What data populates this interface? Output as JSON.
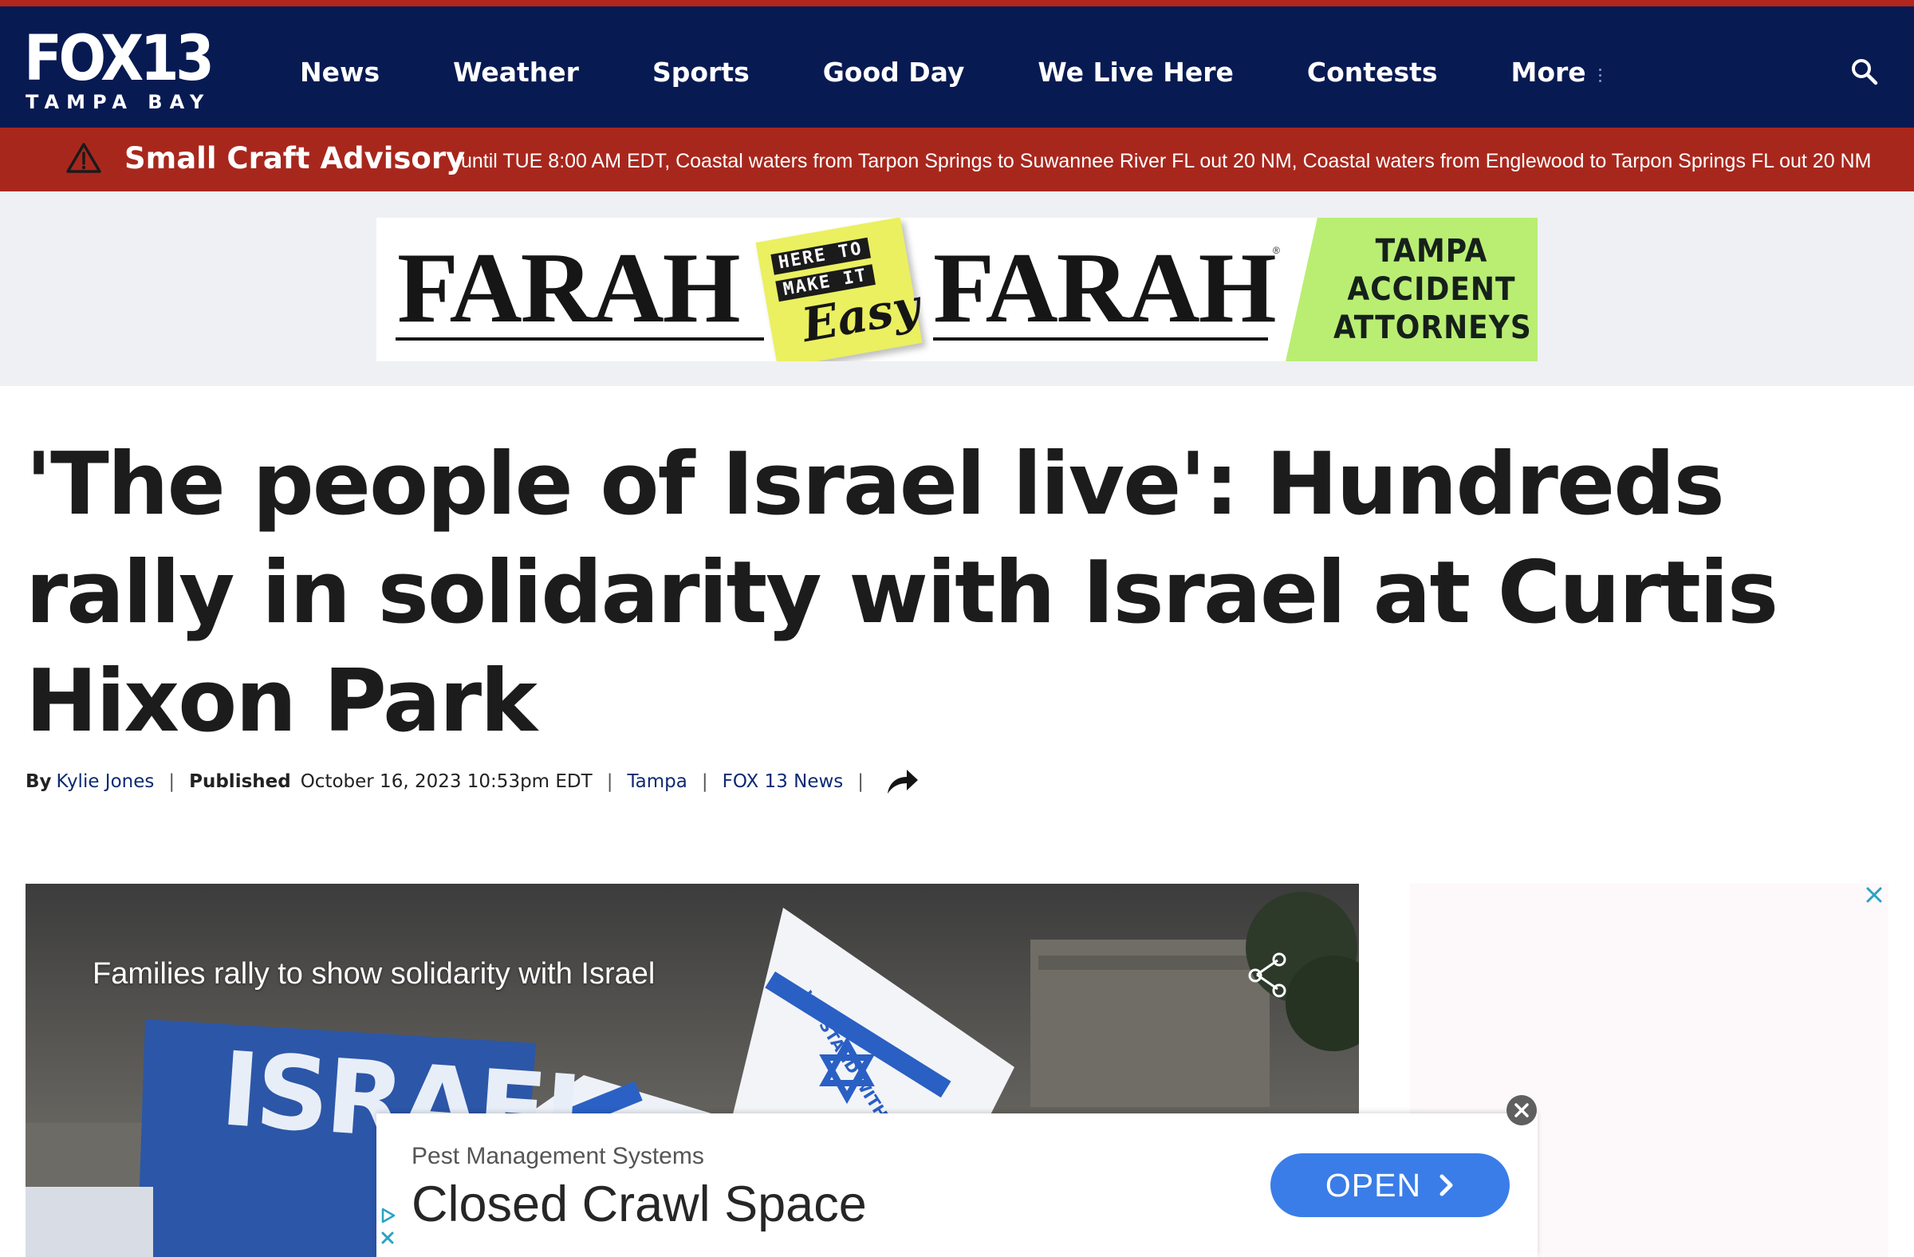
{
  "brand": {
    "logo_main": "FOX13",
    "logo_sub": "TAMPA BAY",
    "nav_color": "#081a52",
    "alert_color": "#a8271d",
    "accent": "#b3261e"
  },
  "nav": {
    "items": [
      "News",
      "Weather",
      "Sports",
      "Good Day",
      "We Live Here",
      "Contests",
      "More"
    ],
    "search_icon": "search-icon"
  },
  "alert": {
    "icon": "warning-triangle-icon",
    "title": "Small Craft Advisory",
    "text": "until TUE 8:00 AM EDT, Coastal waters from Tarpon Springs to Suwannee River FL out 20 NM, Coastal waters from Englewood to Tarpon Springs FL out 20 NM"
  },
  "banner_ad": {
    "name_left": "FARAH",
    "name_right": "FARAH",
    "registered": "®",
    "sticky_line1": "HERE TO",
    "sticky_line2": "MAKE IT",
    "sticky_line3": "Easy",
    "tagline_line1": "TAMPA",
    "tagline_line2": "ACCIDENT",
    "tagline_line3": "ATTORNEYS"
  },
  "article": {
    "headline": "'The people of Israel live': Hundreds rally in solidarity with Israel at Curtis Hixon Park",
    "by_label": "By",
    "author": "Kylie Jones",
    "published_label": "Published",
    "published": "October 16, 2023 10:53pm EDT",
    "location": "Tampa",
    "source": "FOX 13 News",
    "share_icon": "share-arrow-icon"
  },
  "video": {
    "title": "Families rally to show solidarity with Israel",
    "share_icon": "share-icon",
    "sign_text": "ISRAEL",
    "flag_text": "WE STAND WITH ISRAEL"
  },
  "bottom_ad": {
    "sponsor": "Pest Management Systems",
    "title": "Closed Crawl Space",
    "cta": "OPEN",
    "cta_color": "#3a7de8"
  }
}
